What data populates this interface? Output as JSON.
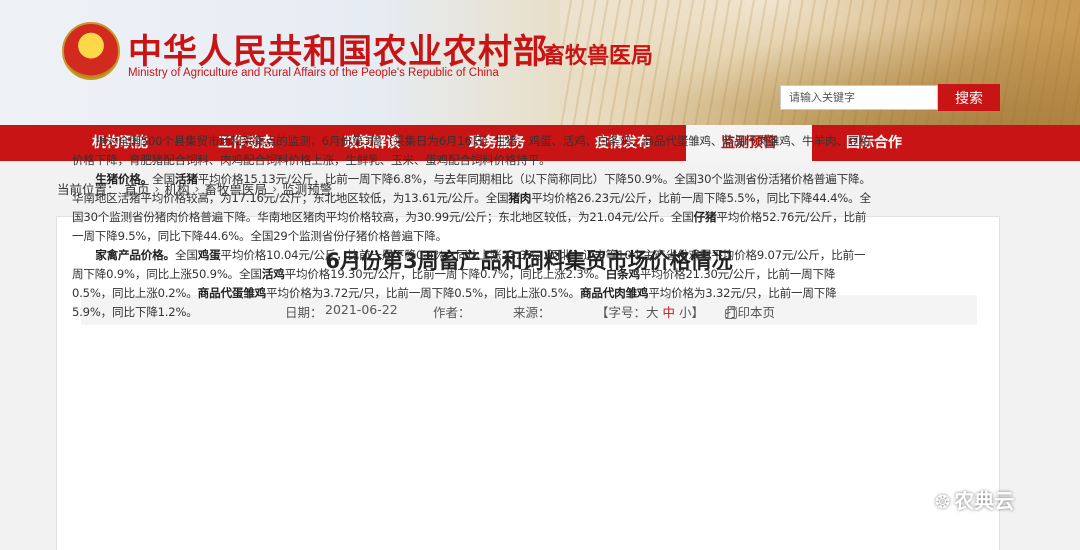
{
  "header": {
    "site_title": "中华人民共和国农业农村部",
    "site_subtitle": "Ministry of Agriculture and Rural Affairs of the People's Republic of China",
    "bureau": "畜牧兽医局",
    "search_placeholder": "请输入关键字",
    "search_button": "搜索"
  },
  "nav": {
    "items": [
      {
        "label": "机构职能"
      },
      {
        "label": "工作动态"
      },
      {
        "label": "政策解读"
      },
      {
        "label": "政务服务"
      },
      {
        "label": "疫情发布"
      },
      {
        "label": "监测预警"
      },
      {
        "label": "国际合作"
      }
    ],
    "active_index": 5
  },
  "breadcrumb": {
    "prefix": "当前位置：",
    "items": [
      "首页",
      "机构",
      "畜牧兽医局",
      "监测预警"
    ],
    "separator": "›"
  },
  "article": {
    "title": "6月份第3周畜产品和饲料集贸市场价格情况",
    "date_label": "日期：",
    "date": "2021-06-22",
    "author_label": "作者：",
    "source_label": "来源：",
    "font_size_label": "【字号：",
    "font_large": "大",
    "font_medium": "中",
    "font_small": "小",
    "font_close": "】",
    "print_label": "打印本页",
    "paragraphs": {
      "p1": "据对全国500个县集贸市场和采集点的监测，6月份第3周（采集日为6月16日）生猪、鸡蛋、活鸡、白条鸡、商品代蛋雏鸡、商品代肉雏鸡、牛羊肉、豆粕价格下降，育肥猪配合饲料、肉鸡配合饲料价格上涨，生鲜乳、玉米、蛋鸡配合饲料价格持平。",
      "p2_head": "生猪价格。",
      "p2_a": "全国",
      "p2_k1": "活猪",
      "p2_b": "平均价格15.13元/公斤，比前一周下降6.8%，与去年同期相比（以下简称同比）下降50.9%。全国30个监测省份活猪价格普遍下降。华南地区活猪平均价格较高，为17.16元/公斤；东北地区较低，为13.61元/公斤。全国",
      "p2_k2": "猪肉",
      "p2_c": "平均价格26.23元/公斤，比前一周下降5.5%，同比下降44.4%。全国30个监测省份猪肉价格普遍下降。华南地区猪肉平均价格较高，为30.99元/公斤；东北地区较低，为21.04元/公斤。全国",
      "p2_k3": "仔猪",
      "p2_d": "平均价格52.76元/公斤，比前一周下降9.5%，同比下降44.6%。全国29个监测省份仔猪价格普遍下降。",
      "p3_head": "家禽产品价格。",
      "p3_a": "全国",
      "p3_k1": "鸡蛋",
      "p3_b": "平均价格10.04元/公斤，比前一周下降0.4%，同比上涨23.3%。河北、辽宁等10个主产省份鸡蛋平均价格9.07元/公斤，比前一周下降0.9%，同比上涨50.9%。全国",
      "p3_k2": "活鸡",
      "p3_c": "平均价格19.30元/公斤，比前一周下降0.7%，同比上涨2.3%。",
      "p3_k3": "白条鸡",
      "p3_d": "平均价格21.30元/公斤，比前一周下降0.5%，同比上涨0.2%。",
      "p3_k4": "商品代蛋雏鸡",
      "p3_e": "平均价格为3.72元/只，比前一周下降0.5%，同比上涨0.5%。",
      "p3_k5": "商品代肉雏鸡",
      "p3_f": "平均价格为3.32元/只，比前一周下降5.9%，同比下降1.2%。"
    }
  },
  "watermark": {
    "icon": "wechat-icon",
    "text": "农典云"
  },
  "colors": {
    "brand_red": "#c81414",
    "nav_active_bg": "#f4f4f4",
    "page_bg": "#f2f2f2"
  }
}
